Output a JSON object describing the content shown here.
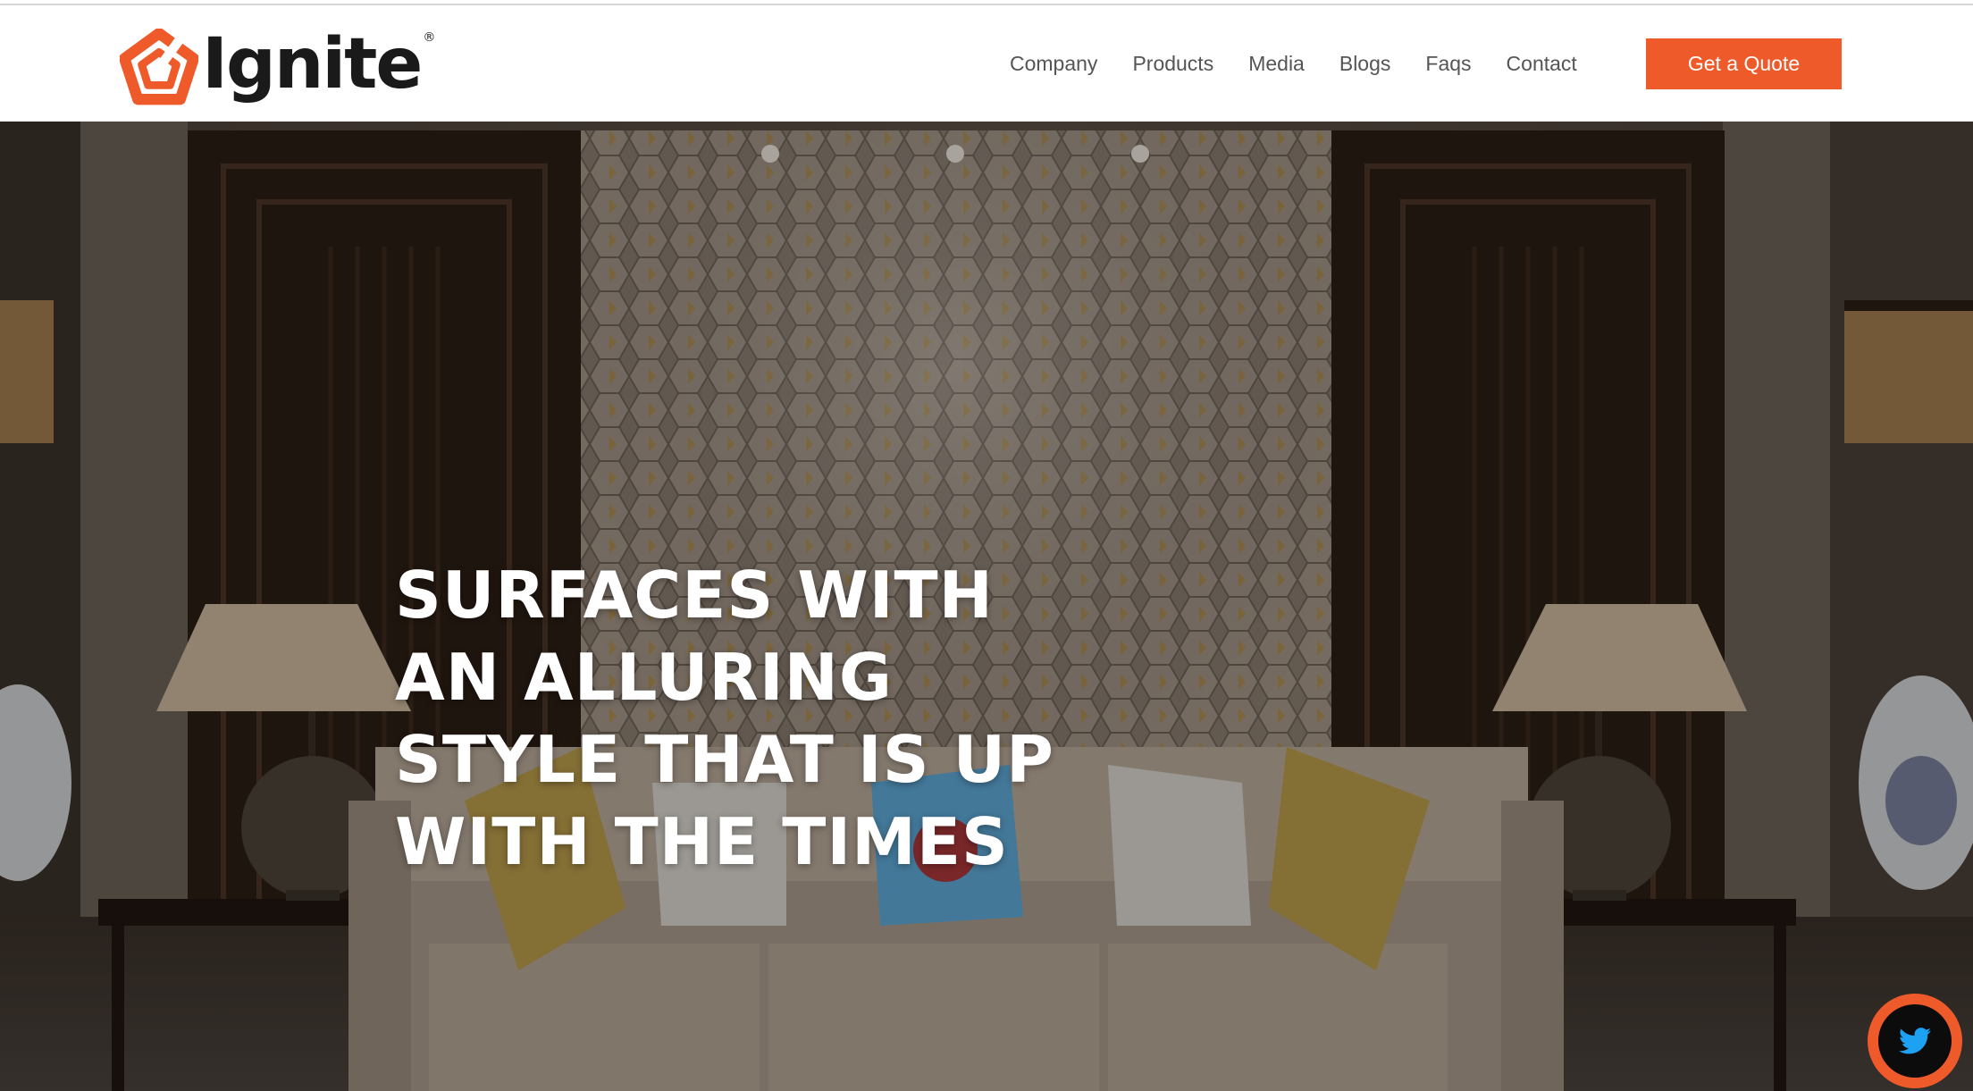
{
  "brand": {
    "name": "Ignite",
    "registered": "®",
    "accent_color": "#ef5a2a"
  },
  "nav": {
    "items": [
      {
        "label": "Company"
      },
      {
        "label": "Products"
      },
      {
        "label": "Media"
      },
      {
        "label": "Blogs"
      },
      {
        "label": "Faqs"
      },
      {
        "label": "Contact"
      }
    ],
    "cta_label": "Get a Quote"
  },
  "hero": {
    "lines": [
      "SURFACES WITH",
      "AN ALLURING",
      "STYLE THAT IS UP",
      "WITH THE TIMES"
    ]
  },
  "social": {
    "twitter_icon": "twitter-bird-icon"
  }
}
